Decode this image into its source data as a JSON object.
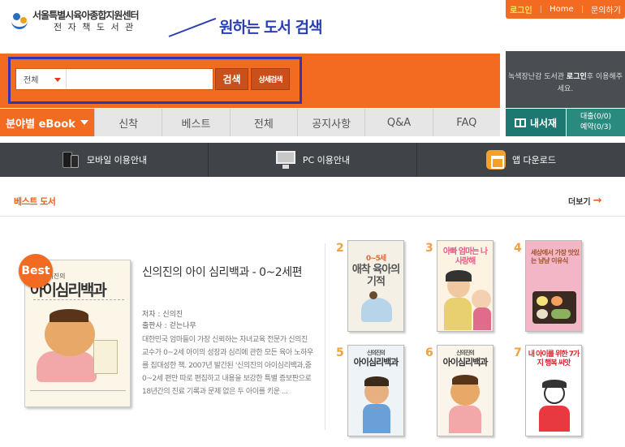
{
  "header": {
    "logo_line1": "서울특별시육아종합지원센터",
    "logo_line2": "전 자 책 도 서 관",
    "annotation": "원하는 도서 검색",
    "top_links": {
      "login": "로그인",
      "home": "Home",
      "contact": "문의하기"
    }
  },
  "search": {
    "scope": "전체",
    "query": "",
    "button": "검색",
    "detail_button": "상세검색"
  },
  "side_panel": {
    "text_pre": "녹색장난감 도서관 ",
    "login": "로그인",
    "text_post": "후 이용해주세요."
  },
  "nav": {
    "genre": "분야별 eBook",
    "items": [
      "신착",
      "베스트",
      "전체",
      "공지사항",
      "Q&A",
      "FAQ"
    ]
  },
  "my_library": {
    "label": "내서재",
    "loan": "대출(0/0)",
    "reserve": "예약(0/3)"
  },
  "info_bar": {
    "mobile": "모바일 이용안내",
    "pc": "PC 이용안내",
    "app": "앱 다운로드"
  },
  "best": {
    "title": "베스트 도서",
    "more": "더보기",
    "badge": "Best",
    "featured": {
      "cover_title": "아이심리백과",
      "cover_small": "신의진의",
      "title": "신의진의 아이 심리백과 - 0~2세편",
      "author": "저자 : 신의진",
      "publisher": "출판사 : 걷는나무",
      "description": "대한민국 엄마들이 가장 신뢰하는 자녀교육 전문가 신의진 교수가 0~2세 아이의 성장과 심리에 관한 모든 육아 노하우를 집대성한 책. 2007년 발간된 '신의진의 아이심리백과,중 0~2세 편만 따로 편집하고 내용을 보강한 특별 증보판으로 18년간의 진료 기록과 문제 없은 두 아이를 키운 ..."
    },
    "list": [
      {
        "rank": "2",
        "cover_title": "애착 육아의 기적",
        "cover_top": "0~5세",
        "color": "#f4f0e6"
      },
      {
        "rank": "3",
        "cover_title": "아빠 엄마는 나 사랑해",
        "cover_top": "",
        "color": "#fdf3e2"
      },
      {
        "rank": "4",
        "cover_title": "세상에서 가장 맛있는 냠냠 이유식",
        "cover_top": "",
        "color": "#f2b6c6"
      },
      {
        "rank": "5",
        "cover_title": "아이심리백과",
        "cover_top": "신의진의",
        "color": "#eef3f7"
      },
      {
        "rank": "6",
        "cover_title": "아이심리백과",
        "cover_top": "신의진의",
        "color": "#fbf4ea"
      },
      {
        "rank": "7",
        "cover_title": "내 아이를 위한 7가지 행복 씨앗",
        "cover_top": "",
        "color": "#ffffff"
      }
    ]
  }
}
